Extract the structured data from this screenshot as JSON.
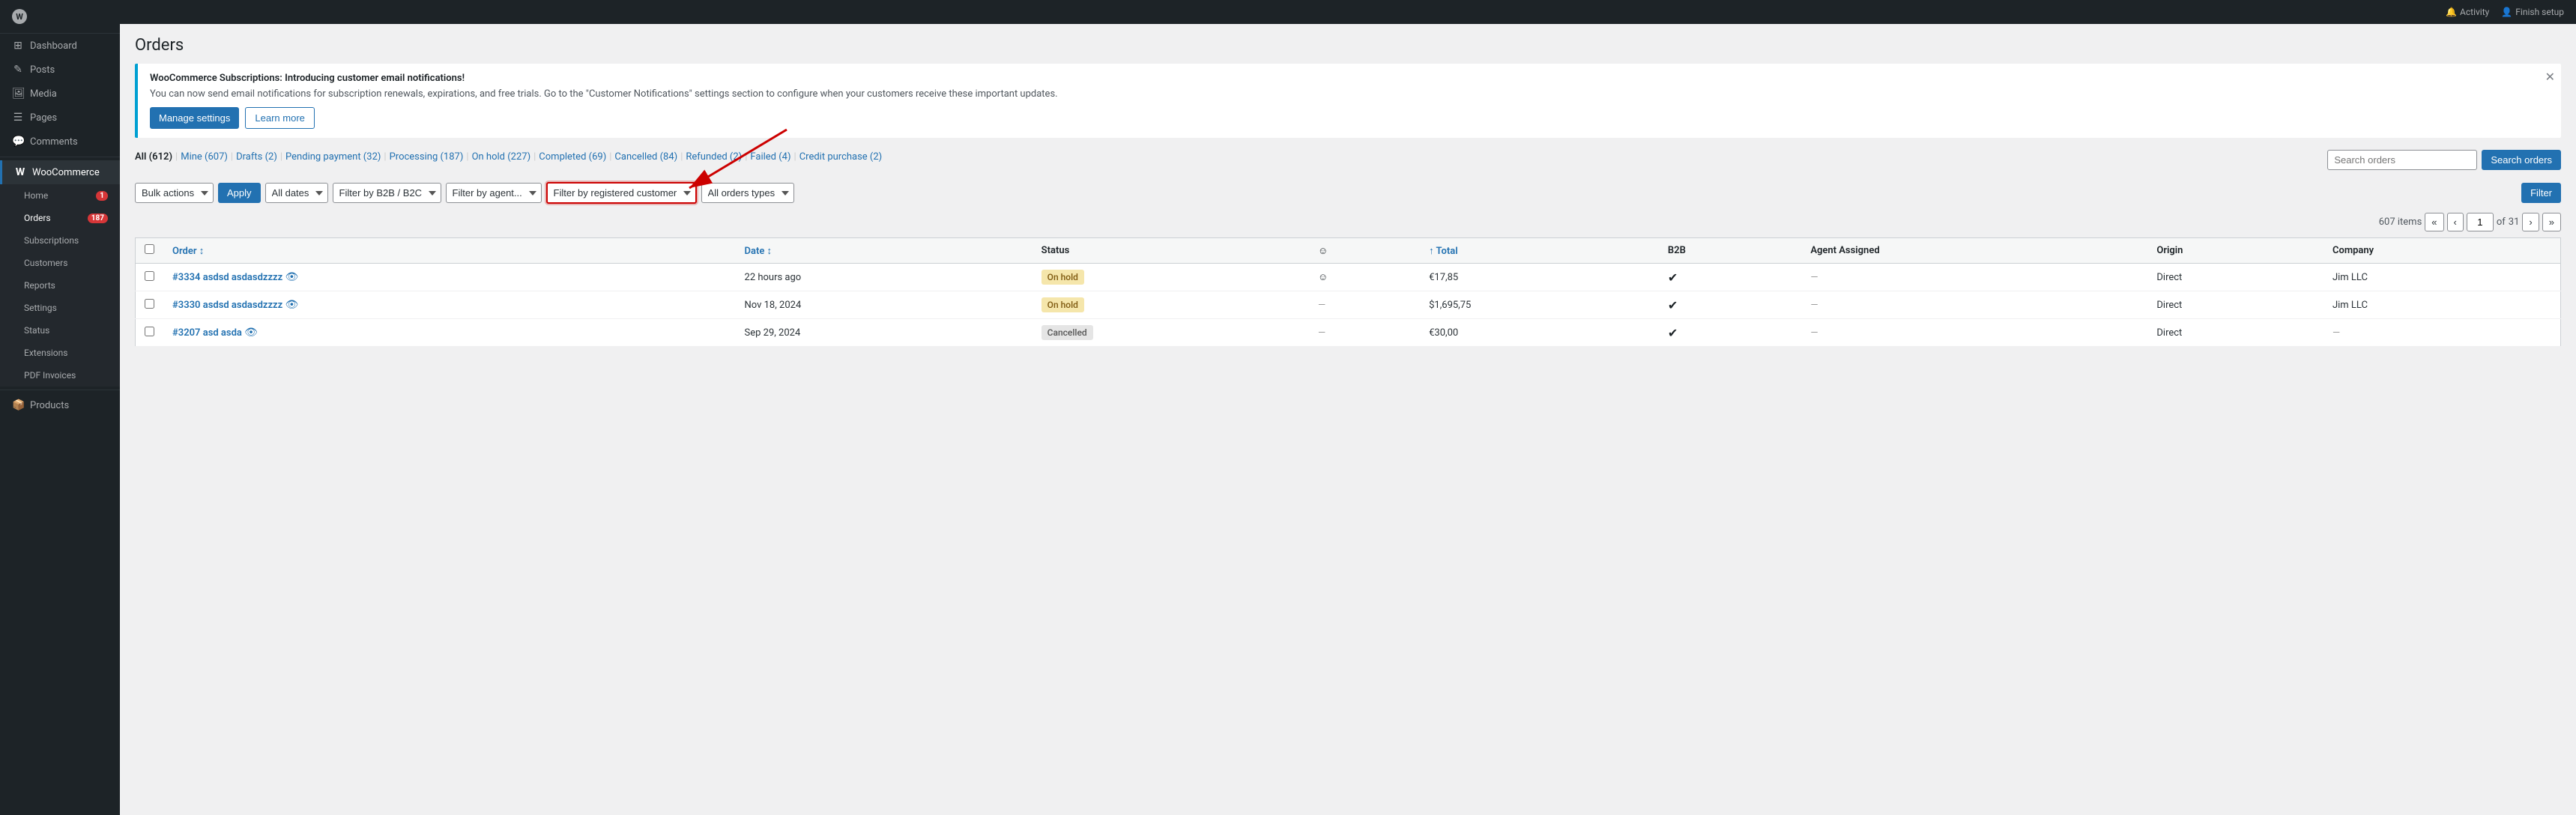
{
  "sidebar": {
    "logo": "W",
    "items": [
      {
        "id": "dashboard",
        "label": "Dashboard",
        "icon": "⊞",
        "badge": null,
        "active": false
      },
      {
        "id": "posts",
        "label": "Posts",
        "icon": "✎",
        "badge": null,
        "active": false
      },
      {
        "id": "media",
        "label": "Media",
        "icon": "⬜",
        "badge": null,
        "active": false
      },
      {
        "id": "pages",
        "label": "Pages",
        "icon": "☰",
        "badge": null,
        "active": false
      },
      {
        "id": "comments",
        "label": "Comments",
        "icon": "💬",
        "badge": null,
        "active": false
      },
      {
        "id": "woocommerce",
        "label": "WooCommerce",
        "icon": "W",
        "badge": null,
        "active": true,
        "isSection": true
      },
      {
        "id": "home",
        "label": "Home",
        "icon": "",
        "badge": "1",
        "active": false,
        "sub": true
      },
      {
        "id": "orders",
        "label": "Orders",
        "icon": "",
        "badge": "187",
        "active": true,
        "sub": true
      },
      {
        "id": "subscriptions",
        "label": "Subscriptions",
        "icon": "",
        "badge": null,
        "active": false,
        "sub": true
      },
      {
        "id": "customers",
        "label": "Customers",
        "icon": "",
        "badge": null,
        "active": false,
        "sub": true
      },
      {
        "id": "reports",
        "label": "Reports",
        "icon": "",
        "badge": null,
        "active": false,
        "sub": true
      },
      {
        "id": "settings",
        "label": "Settings",
        "icon": "",
        "badge": null,
        "active": false,
        "sub": true
      },
      {
        "id": "status",
        "label": "Status",
        "icon": "",
        "badge": null,
        "active": false,
        "sub": true
      },
      {
        "id": "extensions",
        "label": "Extensions",
        "icon": "",
        "badge": null,
        "active": false,
        "sub": true
      },
      {
        "id": "pdf-invoices",
        "label": "PDF Invoices",
        "icon": "",
        "badge": null,
        "active": false,
        "sub": true
      },
      {
        "id": "products",
        "label": "Products",
        "icon": "📦",
        "badge": null,
        "active": false,
        "isSection": true
      }
    ]
  },
  "topbar": {
    "activity_label": "Activity",
    "finish_setup_label": "Finish setup"
  },
  "page": {
    "title": "Orders"
  },
  "notification": {
    "title": "WooCommerce Subscriptions: Introducing customer email notifications!",
    "text": "You can now send email notifications for subscription renewals, expirations, and free trials. Go to the \"Customer Notifications\" settings section to configure when your customers receive these important updates.",
    "manage_settings_label": "Manage settings",
    "learn_more_label": "Learn more"
  },
  "order_tabs": [
    {
      "id": "all",
      "label": "All",
      "count": "(612)",
      "active": true
    },
    {
      "id": "mine",
      "label": "Mine",
      "count": "(607)",
      "active": false
    },
    {
      "id": "drafts",
      "label": "Drafts",
      "count": "(2)",
      "active": false
    },
    {
      "id": "pending",
      "label": "Pending payment",
      "count": "(32)",
      "active": false
    },
    {
      "id": "processing",
      "label": "Processing",
      "count": "(187)",
      "active": false
    },
    {
      "id": "on-hold",
      "label": "On hold",
      "count": "(227)",
      "active": false
    },
    {
      "id": "completed",
      "label": "Completed",
      "count": "(69)",
      "active": false
    },
    {
      "id": "cancelled",
      "label": "Cancelled",
      "count": "(84)",
      "active": false
    },
    {
      "id": "refunded",
      "label": "Refunded",
      "count": "(2)",
      "active": false
    },
    {
      "id": "failed",
      "label": "Failed",
      "count": "(4)",
      "active": false
    },
    {
      "id": "credit-purchase",
      "label": "Credit purchase",
      "count": "(2)",
      "active": false
    }
  ],
  "filters": {
    "bulk_actions_label": "Bulk actions",
    "apply_label": "Apply",
    "all_dates_label": "All dates",
    "b2b_label": "Filter by B2B / B2C",
    "agent_label": "Filter by agent...",
    "registered_customer_label": "Filter by registered customer",
    "order_types_label": "All orders types",
    "filter_label": "Filter",
    "search_placeholder": "Search orders",
    "search_label": "Search orders"
  },
  "pagination": {
    "items_count": "607 items",
    "page_current": "1",
    "page_total": "31"
  },
  "table": {
    "columns": [
      {
        "id": "order",
        "label": "Order",
        "sortable": true
      },
      {
        "id": "date",
        "label": "Date",
        "sortable": true
      },
      {
        "id": "status",
        "label": "Status",
        "sortable": false
      },
      {
        "id": "smiley",
        "label": "☺",
        "sortable": false
      },
      {
        "id": "total",
        "label": "↑ Total",
        "sortable": true
      },
      {
        "id": "b2b",
        "label": "B2B",
        "sortable": false
      },
      {
        "id": "agent",
        "label": "Agent Assigned",
        "sortable": false
      },
      {
        "id": "origin",
        "label": "Origin",
        "sortable": false
      },
      {
        "id": "company",
        "label": "Company",
        "sortable": false
      }
    ],
    "rows": [
      {
        "order": "#3334 asdsd asdasdzzzz",
        "date": "22 hours ago",
        "status": "On hold",
        "status_type": "on-hold",
        "smiley": "☺",
        "total": "€17,85",
        "b2b": "✓",
        "agent": "—",
        "origin": "Direct",
        "company": "Jim LLC"
      },
      {
        "order": "#3330 asdsd asdasdzzzz",
        "date": "Nov 18, 2024",
        "status": "On hold",
        "status_type": "on-hold",
        "smiley": "—",
        "total": "$1,695,75",
        "b2b": "✓",
        "agent": "—",
        "origin": "Direct",
        "company": "Jim LLC"
      },
      {
        "order": "#3207 asd asda",
        "date": "Sep 29, 2024",
        "status": "Cancelled",
        "status_type": "cancelled",
        "smiley": "—",
        "total": "€30,00",
        "b2b": "✓",
        "agent": "—",
        "origin": "Direct",
        "company": "—"
      }
    ]
  }
}
